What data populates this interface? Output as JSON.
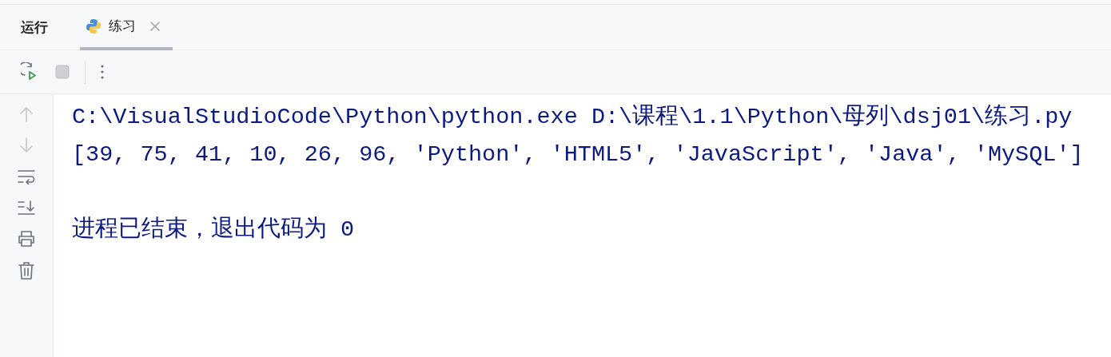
{
  "panel": {
    "title": "运行"
  },
  "tabs": [
    {
      "label": "练习",
      "selected": true
    }
  ],
  "toolbar": [
    {
      "kind": "rerun"
    },
    {
      "kind": "stop"
    },
    {
      "kind": "more"
    }
  ],
  "gutter": [
    {
      "kind": "up",
      "disabled": true
    },
    {
      "kind": "down",
      "disabled": true
    },
    {
      "kind": "wrap",
      "disabled": false
    },
    {
      "kind": "scroll-end",
      "disabled": false
    },
    {
      "kind": "print",
      "disabled": false
    },
    {
      "kind": "clear",
      "disabled": false
    }
  ],
  "console": {
    "lines": [
      {
        "kind": "command",
        "text": "C:\\VisualStudioCode\\Python\\python.exe D:\\课程\\1.1\\Python\\母列\\dsj01\\练习.py"
      },
      {
        "kind": "output",
        "text": "[39, 75, 41, 10, 26, 96, 'Python', 'HTML5', 'JavaScript', 'Java', 'MySQL']"
      },
      {
        "kind": "exit",
        "text": "进程已结束，退出代码为 0"
      }
    ]
  }
}
